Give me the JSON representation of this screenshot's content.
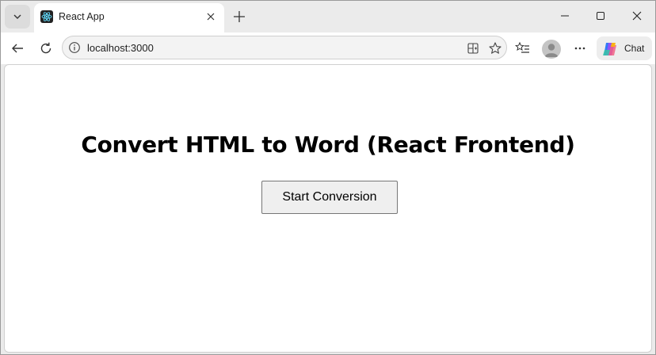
{
  "browser": {
    "tab": {
      "title": "React App",
      "favicon": "react-icon"
    },
    "address_bar": {
      "url": "localhost:3000"
    },
    "toolbar": {
      "chat_label": "Chat"
    },
    "icons": {
      "tab_actions": "chevron-down-icon",
      "tab_close": "close-icon",
      "new_tab": "plus-icon",
      "minimize": "minimize-icon",
      "maximize": "maximize-icon",
      "close_window": "close-icon",
      "back": "back-arrow-icon",
      "refresh": "refresh-icon",
      "site_info": "info-icon",
      "split_screen": "split-screen-icon",
      "favorite": "star-icon",
      "favorites": "favorites-list-icon",
      "profile": "profile-avatar",
      "more": "more-icon",
      "copilot": "copilot-icon"
    }
  },
  "page": {
    "heading": "Convert HTML to Word (React Frontend)",
    "start_button_label": "Start Conversion"
  },
  "colors": {
    "tabstrip_bg": "#ebebeb",
    "tab_active_bg": "#ffffff",
    "button_bg": "#efefef",
    "button_border": "#767676"
  }
}
